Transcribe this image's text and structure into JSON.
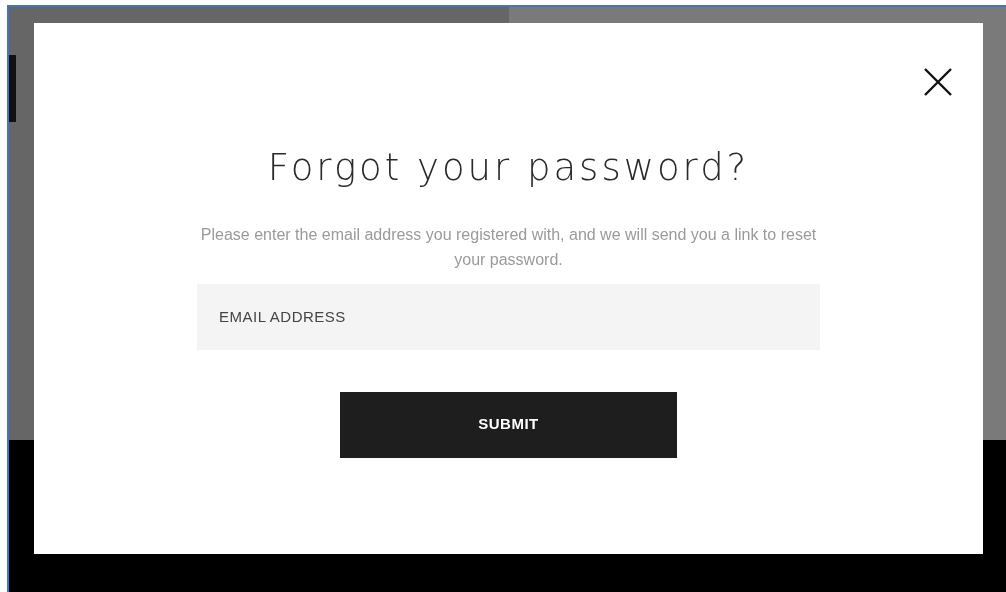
{
  "modal": {
    "title": "Forgot your password?",
    "message": "Please enter the email address you registered with, and we will send you a link to reset your password.",
    "email_field": {
      "placeholder": "EMAIL ADDRESS"
    },
    "submit_button": "SUBMIT"
  }
}
